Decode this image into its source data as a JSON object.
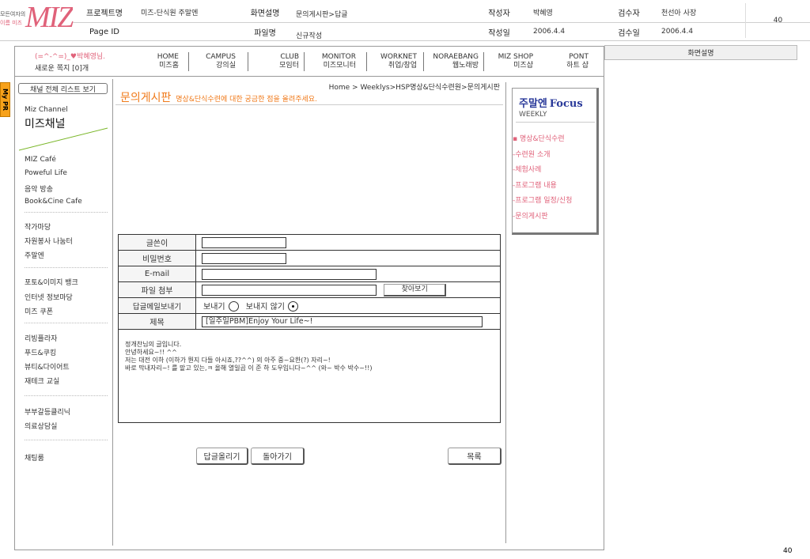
{
  "header": {
    "logo_small_top": "모든여자의",
    "logo_small_bottom": "이름 미즈",
    "logo_big": "MIZ",
    "project_label": "프로젝트명",
    "project_value": "미즈-단식원 주말엔",
    "screen_desc_label": "화면설명",
    "screen_desc_value": "문의게시판>답글",
    "author_label": "작성자",
    "author_value": "박혜영",
    "reviewer_label": "검수자",
    "reviewer_value": "천선아 사장",
    "page_number": "40",
    "page_id_label": "Page ID",
    "filename_label": "파일명",
    "filename_value": "신규작성",
    "date_label": "작성일",
    "date_value": "2006.4.4",
    "review_date_label": "검수일",
    "review_date_value": "2006.4.4",
    "screen_explain_label": "화면설명"
  },
  "user": {
    "greeting": "(=^-^=)_♥박혜영님.",
    "notes": "새로운 쪽지 [0]개"
  },
  "nav": [
    {
      "top": "HOME",
      "bottom": "미즈홈"
    },
    {
      "top": "CAMPUS",
      "bottom": "강의실"
    },
    {
      "top": "CLUB",
      "bottom": "모임터"
    },
    {
      "top": "MONITOR",
      "bottom": "미즈모니터"
    },
    {
      "top": "WORKNET",
      "bottom": "취업/창업"
    },
    {
      "top": "NORAEBANG",
      "bottom": "웹노래방"
    },
    {
      "top": "MIZ SHOP",
      "bottom": "미즈샵"
    },
    {
      "top": "PONT",
      "bottom": "하트 샵"
    }
  ],
  "mypr_tab": "My PR",
  "sidebar": {
    "list_button": "채널 전체 리스트 보기",
    "channel_en": "Miz Channel",
    "channel_ko": "미즈채널",
    "groups": [
      [
        "MIZ Café",
        "Poweful Life",
        "음악 방송",
        "Book&Cine Cafe"
      ],
      [
        "작가마당",
        "자원봉사 나눔터",
        "주말엔"
      ],
      [
        "포토&이미지 뱅크",
        "인터넷 정보마당",
        "미즈 쿠폰"
      ],
      [
        "리빙플라자",
        "푸드&쿠킹",
        "뷰티&다이어트",
        "재테크 교실"
      ],
      [
        "부부갈등클리닉",
        "의료상담실"
      ],
      [
        "채팅룸"
      ]
    ]
  },
  "breadcrumb": "Home > Weeklys>HSP명상&단식수련원>문의게시판",
  "page_title": "문의게시판",
  "page_subtitle": "명상&단식수련에 대한 궁금한 점을 올려주세요.",
  "form": {
    "writer_label": "글쓴이",
    "password_label": "비밀번호",
    "email_label": "E-mail",
    "attach_label": "파일 첨부",
    "browse_button": "찾아보기",
    "reply_mail_label": "답글메일보내기",
    "send_option": "보내기",
    "nosend_option": "보내지 않기",
    "subject_label": "제목",
    "subject_value": "[일주일PBM]Enjoy Your Life~!",
    "body_lines": [
      "정개찬님의 글입니다.",
      "안녕하세요~!! ^^",
      "저는 대전 이하 (이하가 뭔지 다들 아시죠,??^^) 의 아주 중~요한(?) 자리~!",
      "바로 막내자리~! 를 맡고 있는,ㅋ 올해 열일곱 이 준 하 도우입니다~^^ (와~ 박수 박수~!!)"
    ]
  },
  "buttons": {
    "submit": "답글올리기",
    "back": "돌아가기",
    "list": "목록"
  },
  "focus": {
    "title_ko": "주말엔",
    "title_en": "Focus",
    "weekly": "WEEKLY",
    "items": [
      "▪ 명상&단식수련",
      "-수련원 소개",
      "-체험사례",
      "-프로그램 내용",
      "-프로그램 일정/신청",
      "-문의게시판"
    ]
  },
  "footer_page": "40",
  "colors": {
    "accent": "#e0627a",
    "title_orange": "#f07a1a",
    "focus_blue": "#2a3a9a"
  }
}
